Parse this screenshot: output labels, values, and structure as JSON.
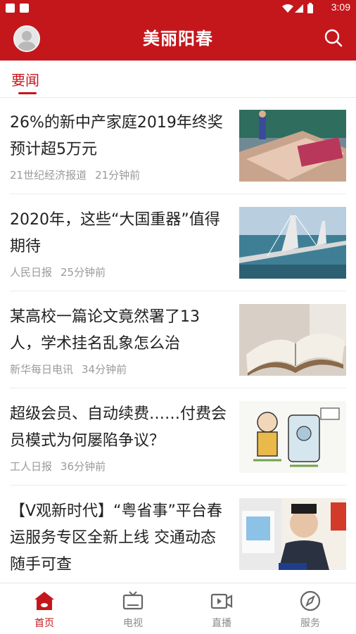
{
  "status_bar": {
    "time": "3:09"
  },
  "app_bar": {
    "title": "美丽阳春"
  },
  "tabs": [
    {
      "label": "要闻",
      "active": true
    }
  ],
  "news": [
    {
      "title": "26%的新中产家庭2019年终奖预计超5万元",
      "source": "21世纪经济报道",
      "time": "21分钟前"
    },
    {
      "title": "2020年，这些“大国重器”值得期待",
      "source": "人民日报",
      "time": "25分钟前"
    },
    {
      "title": "某高校一篇论文竟然署了13人，学术挂名乱象怎么治",
      "source": "新华每日电讯",
      "time": "34分钟前"
    },
    {
      "title": "超级会员、自动续费……付费会员模式为何屡陷争议？",
      "source": "工人日报",
      "time": "36分钟前"
    },
    {
      "title": "【V观新时代】“粤省事”平台春运服务专区全新上线 交通动态随手可查"
    }
  ],
  "bottom_nav": [
    {
      "label": "首页",
      "icon": "home-icon",
      "active": true
    },
    {
      "label": "电视",
      "icon": "tv-icon"
    },
    {
      "label": "直播",
      "icon": "live-video-icon"
    },
    {
      "label": "服务",
      "icon": "compass-icon"
    }
  ],
  "colors": {
    "brand": "#c4171c",
    "text": "#222222",
    "meta": "#9a9a9a"
  }
}
